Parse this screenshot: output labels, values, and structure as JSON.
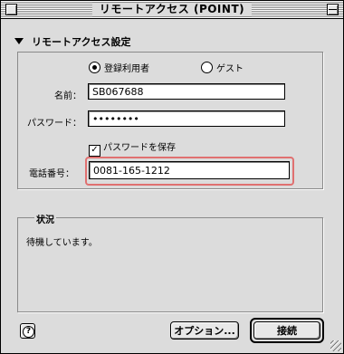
{
  "window": {
    "title": "リモートアクセス (POINT)"
  },
  "section": {
    "title": "リモートアクセス設定"
  },
  "radio": {
    "registered_label": "登録利用者",
    "registered_selected": true,
    "guest_label": "ゲスト",
    "guest_selected": false
  },
  "fields": {
    "name_label": "名前：",
    "name_value": "SB067688",
    "password_label": "パスワード：",
    "password_value": "••••••••",
    "phone_label": "電話番号：",
    "phone_value": "0081-165-1212"
  },
  "save_password": {
    "label": "パスワードを保存",
    "checked": true,
    "check_glyph": "✓"
  },
  "status": {
    "title": "状況",
    "text": "待機しています。"
  },
  "buttons": {
    "help_glyph": "?",
    "options_label": "オプション...",
    "connect_label": "接続"
  },
  "icons": [
    "close-box-icon",
    "collapse-box-icon",
    "disclosure-triangle-icon",
    "help-icon",
    "resize-grip-icon"
  ]
}
